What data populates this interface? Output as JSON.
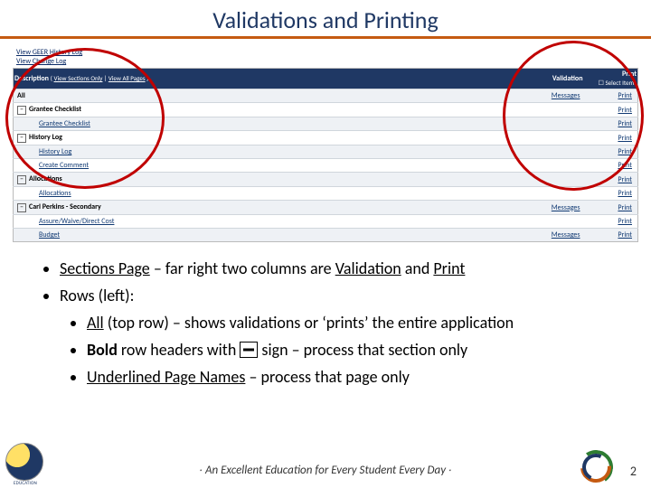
{
  "title": "Validations and Printing",
  "screenshot": {
    "top_links": {
      "view_history": "View GEER History Log",
      "view_change": "View Change Log"
    },
    "header": {
      "description_label": "Description",
      "view_sections_only": "View Sections Only",
      "view_all_pages": "View All Pages",
      "validation_label": "Validation",
      "print_label": "Print",
      "select_items_label": "Select Items"
    },
    "rows": [
      {
        "type": "section",
        "label": "All",
        "validation": "Messages",
        "print": "Print",
        "shade": true
      },
      {
        "type": "section",
        "label": "Grantee Checklist",
        "collapsible": true,
        "print": "Print"
      },
      {
        "type": "page",
        "label": "Grantee Checklist",
        "print": "Print",
        "shade": true
      },
      {
        "type": "section",
        "label": "History Log",
        "collapsible": true,
        "print": "Print"
      },
      {
        "type": "page",
        "label": "History Log",
        "print": "Print",
        "shade": true
      },
      {
        "type": "page",
        "label": "Create Comment",
        "print": "Print"
      },
      {
        "type": "section",
        "label": "Allocations",
        "collapsible": true,
        "print": "Print",
        "shade": true
      },
      {
        "type": "page",
        "label": "Allocations",
        "print": "Print"
      },
      {
        "type": "section",
        "label": "Carl Perkins - Secondary",
        "collapsible": true,
        "validation": "Messages",
        "print": "Print",
        "shade": true
      },
      {
        "type": "page",
        "label": "Assure/Waive/Direct Cost",
        "print": "Print"
      },
      {
        "type": "page",
        "label": "Budget",
        "validation": "Messages",
        "print": "Print",
        "shade": true
      }
    ]
  },
  "bullets": {
    "l1": {
      "prefix": "Sections Page",
      "rest": " – far right two columns are ",
      "v": "Validation",
      "and": " and ",
      "p": "Print"
    },
    "l2": "Rows (left):",
    "l2a": {
      "u": "All",
      "rest": " (top row) –  shows validations or ‘prints’ the entire application"
    },
    "l2b": {
      "b": "Bold",
      "mid": " row headers with ",
      "rest": "  sign – process that section only"
    },
    "l2c": {
      "u": "Underlined Page Names",
      "rest": " – process that page only"
    }
  },
  "footer": "∙ An Excellent Education for Every Student Every Day ∙",
  "page_number": "2",
  "logo_left_label": "EDUCATION"
}
